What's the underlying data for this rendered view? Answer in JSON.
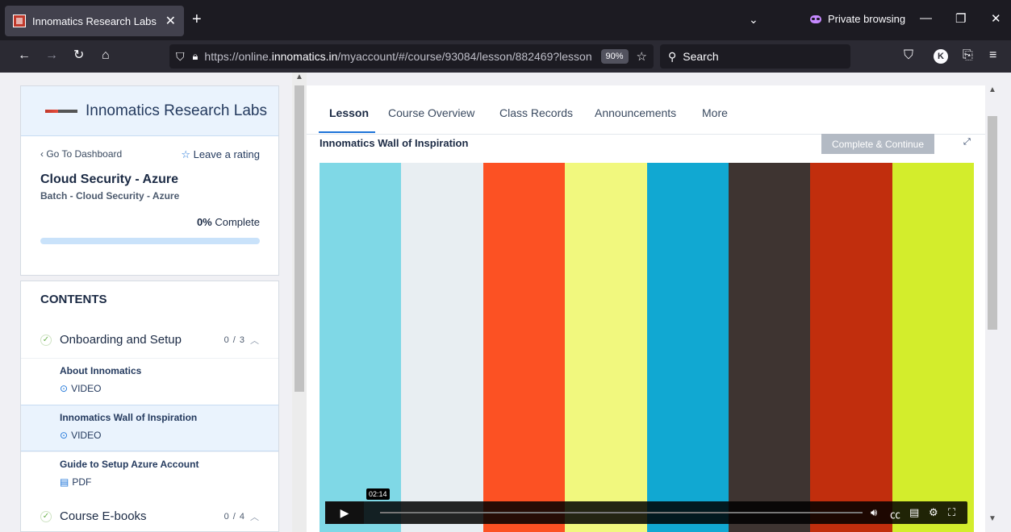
{
  "browser": {
    "tab_title": "Innomatics Research Labs",
    "tab_close": "✕",
    "new_tab": "+",
    "tab_list": "⌄",
    "private_label": "Private browsing",
    "minimize": "—",
    "restore": "❐",
    "close": "✕",
    "url_host_prefix": "https://online.",
    "url_host": "innomatics.in",
    "url_path": "/myaccount/#/course/93084/lesson/882469?lesson",
    "zoom": "90%",
    "search_label": "Search",
    "account_initial": "K"
  },
  "sidebar": {
    "brand_name": "Innomatics Research Labs",
    "back_link": "‹ Go To Dashboard",
    "rate_label": "Leave a rating",
    "course_title": "Cloud Security - Azure",
    "batch": "Batch - Cloud Security - Azure",
    "complete_percent": "0%",
    "complete_suffix": " Complete",
    "progress_fraction": 0.0,
    "contents_heading": "CONTENTS",
    "sections": [
      {
        "label": "Onboarding and Setup",
        "count": "0 / 3",
        "lessons": [
          {
            "title": "About Innomatics",
            "kind": "VIDEO"
          },
          {
            "title": "Innomatics Wall of Inspiration",
            "kind": "VIDEO"
          },
          {
            "title": "Guide to Setup Azure Account",
            "kind": "PDF"
          }
        ]
      },
      {
        "label": "Course E-books",
        "count": "0 / 4"
      }
    ]
  },
  "main": {
    "tabs": [
      "Lesson",
      "Course Overview",
      "Class Records",
      "Announcements",
      "More"
    ],
    "lesson_title": "Innomatics Wall of Inspiration",
    "continue_label": "Complete & Continue",
    "player": {
      "time": "02:14",
      "bar_colors": [
        "#7fd8e6",
        "#e8eef2",
        "#fc5123",
        "#f1f87e",
        "#11a8d2",
        "#3e3431",
        "#c12e0d",
        "#d3ed2c"
      ]
    }
  }
}
